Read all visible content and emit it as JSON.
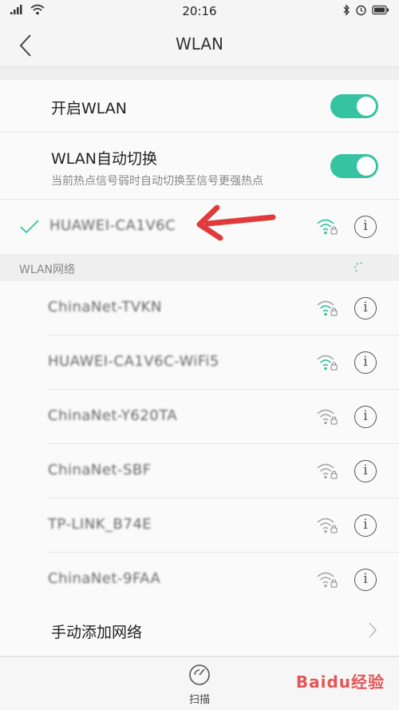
{
  "status_bar": {
    "time": "20:16",
    "icons": [
      "signal-icon",
      "wifi-icon",
      "bluetooth-icon",
      "alarm-icon",
      "battery-icon"
    ]
  },
  "nav": {
    "title": "WLAN"
  },
  "settings": {
    "wlan_toggle": {
      "label": "开启WLAN",
      "on": true
    },
    "auto_switch": {
      "label": "WLAN自动切换",
      "description": "当前热点信号弱时自动切换至信号更强热点",
      "on": true
    }
  },
  "connected": {
    "name": "HUAWEI-CA1V6C",
    "secured": true
  },
  "networks_section": {
    "label": "WLAN网络"
  },
  "networks": [
    {
      "name": "ChinaNet-TVKN",
      "secured": true
    },
    {
      "name": "HUAWEI-CA1V6C-WiFi5",
      "secured": true
    },
    {
      "name": "ChinaNet-Y620TA",
      "secured": true
    },
    {
      "name": "ChinaNet-SBF",
      "secured": true
    },
    {
      "name": "TP-LINK_B74E",
      "secured": true
    },
    {
      "name": "ChinaNet-9FAA",
      "secured": true
    }
  ],
  "manual_add": {
    "label": "手动添加网络"
  },
  "bottom": {
    "scan_label": "扫描"
  },
  "watermark": "Baidu经验",
  "colors": {
    "accent": "#35c3a1",
    "arrow": "#e03b3b"
  }
}
